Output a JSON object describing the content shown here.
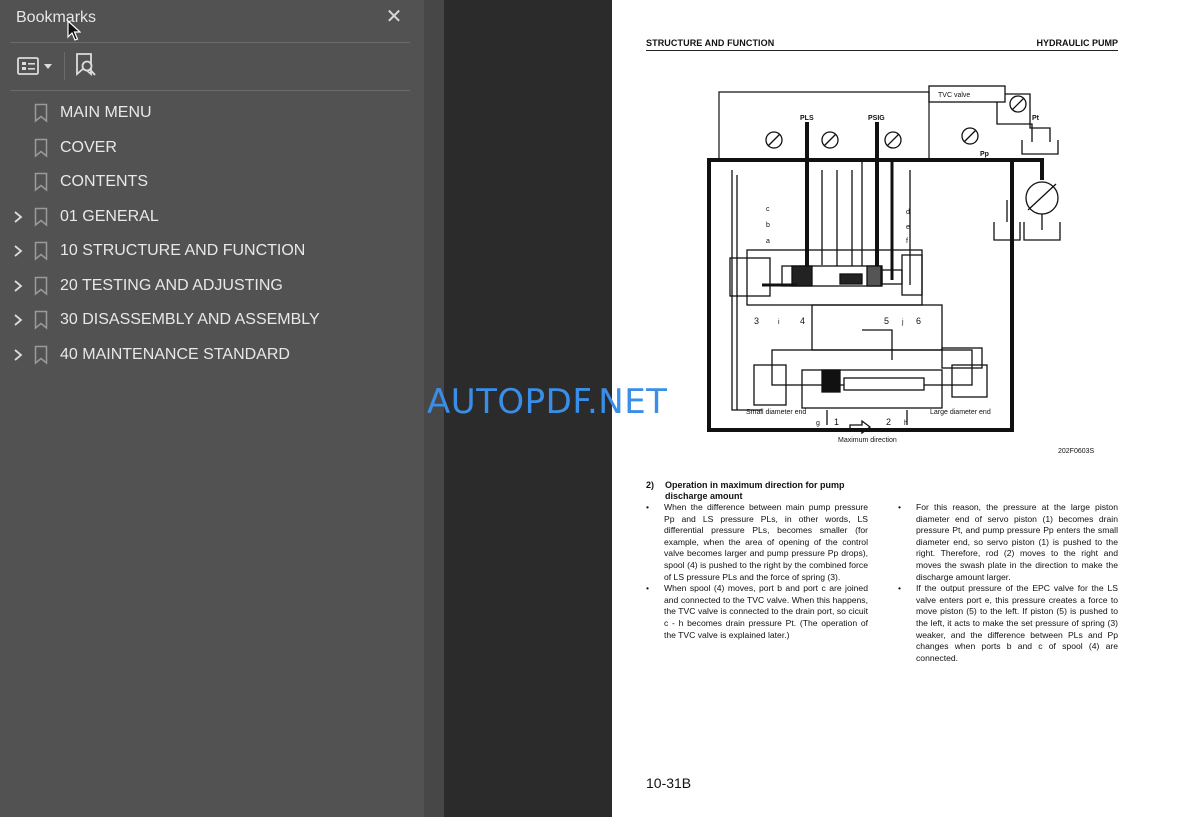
{
  "sidebar": {
    "title": "Bookmarks",
    "items": [
      {
        "label": "MAIN MENU",
        "expandable": false
      },
      {
        "label": "COVER",
        "expandable": false
      },
      {
        "label": "CONTENTS",
        "expandable": false
      },
      {
        "label": "01 GENERAL",
        "expandable": true
      },
      {
        "label": "10 STRUCTURE AND FUNCTION",
        "expandable": true
      },
      {
        "label": "20 TESTING AND ADJUSTING",
        "expandable": true
      },
      {
        "label": "30 DISASSEMBLY AND ASSEMBLY",
        "expandable": true
      },
      {
        "label": "40 MAINTENANCE STANDARD",
        "expandable": true
      }
    ]
  },
  "page": {
    "header_left": "STRUCTURE AND FUNCTION",
    "header_right": "HYDRAULIC PUMP",
    "diagram": {
      "tvc_valve": "TVC valve",
      "pls": "PLS",
      "psig": "PSIG",
      "pt": "Pt",
      "pp": "Pp",
      "small_end": "Small diameter end",
      "large_end": "Large diameter end",
      "max_dir": "Maximum direction",
      "labels": [
        "c",
        "b",
        "a",
        "d",
        "e",
        "f",
        "3",
        "i",
        "4",
        "5",
        "j",
        "6",
        "g",
        "1",
        "2",
        "h"
      ]
    },
    "figure_code": "202F0603S",
    "section_number": "2)",
    "section_title": "Operation in maximum direction for pump discharge amount",
    "left_paragraphs": [
      "When the difference between main pump pressure Pp and LS pressure PLs, in other words, LS differential pressure PLs, becomes smaller (for example, when the area of opening of the control valve becomes larger and pump pressure Pp drops), spool (4) is pushed to the right by the combined force of LS pressure PLs and the force of spring (3).",
      "When spool (4) moves, port b and port c are joined and connected to the TVC valve. When this happens, the TVC valve is connected to the drain port, so cicuit c - h becomes drain pressure Pt. (The operation of the TVC valve is explained later.)"
    ],
    "right_paragraphs": [
      "For this reason, the pressure at the large piston diameter end of servo piston (1) becomes drain pressure Pt, and pump pressure Pp enters the small diameter end, so servo piston (1) is pushed to the right. Therefore, rod (2) moves to the right and moves the swash plate in the direction to make the discharge amount larger.",
      "If the output pressure of the EPC valve for the LS valve enters port e, this pressure creates a force to move piston (5) to the left. If piston (5) is pushed to the left, it acts to make the set pressure of spring (3) weaker, and the difference between PLs and Pp changes when ports b and c of spool (4) are connected."
    ],
    "bullet": "•",
    "page_number": "10-31B"
  },
  "watermark": "AUTOPDF.NET",
  "colors": {
    "sidebar_bg": "#525252",
    "viewer_bg": "#2b2b2b",
    "watermark": "#3a8ee8"
  }
}
